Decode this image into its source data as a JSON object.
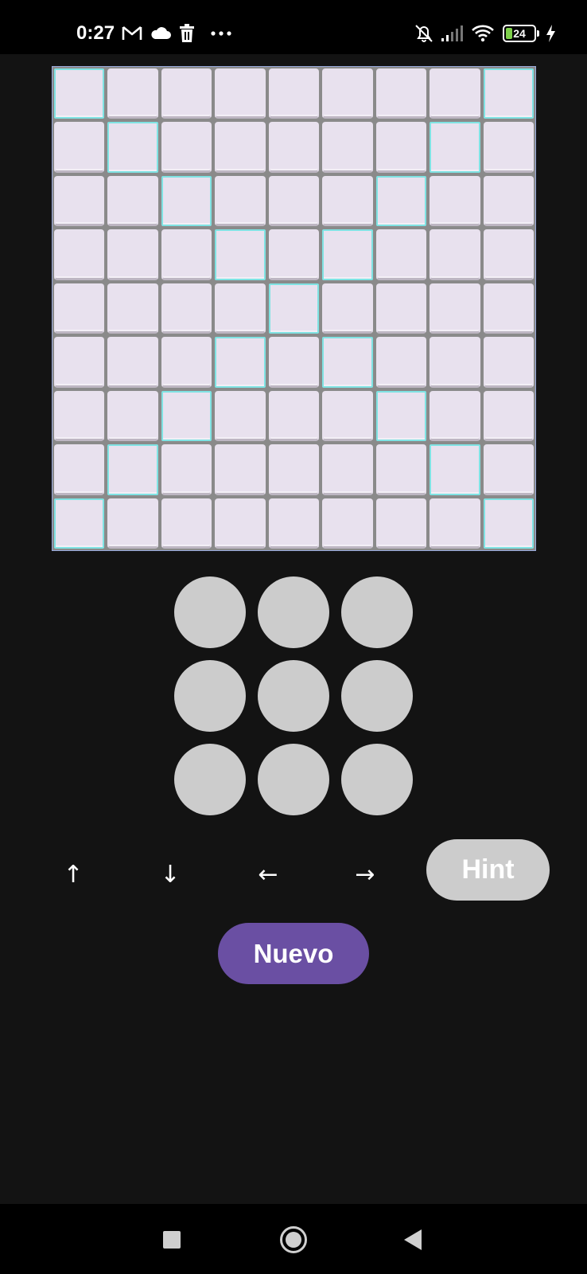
{
  "status_bar": {
    "time": "0:27",
    "battery_level": "24",
    "icons": [
      "gmail-icon",
      "cloud-icon",
      "trash-icon",
      "more-dots-icon",
      "mute-icon",
      "signal-icon",
      "wifi-icon",
      "battery-icon",
      "charging-icon"
    ]
  },
  "board": {
    "rows": 9,
    "cols": 9,
    "highlight_pattern": "diagonals",
    "cell_color": "#e8e1ee",
    "highlight_color": "#7fe3e3"
  },
  "number_pad": {
    "button_count": 9,
    "button_color": "#cccccc"
  },
  "controls": {
    "up": "↑",
    "down": "↓",
    "left": "←",
    "right": "→",
    "hint_label": "Hint",
    "new_label": "Nuevo"
  },
  "colors": {
    "background": "#131313",
    "accent": "#6a4fa3",
    "button_gray": "#cccccc"
  }
}
